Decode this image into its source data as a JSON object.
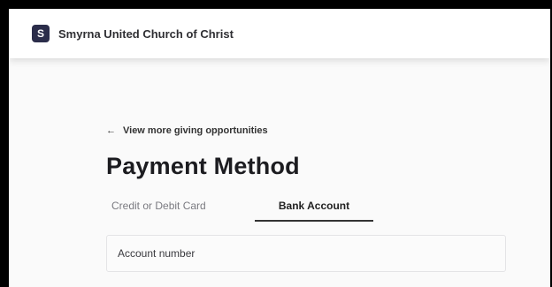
{
  "header": {
    "logo_letter": "S",
    "church_name": "Smyrna United Church of Christ"
  },
  "navigation": {
    "back_arrow": "←",
    "back_link": "View more giving opportunities"
  },
  "page": {
    "title": "Payment Method"
  },
  "tabs": [
    {
      "label": "Credit or Debit Card",
      "selected": false
    },
    {
      "label": "Bank Account",
      "selected": true
    }
  ],
  "form": {
    "account_number": {
      "placeholder": "Account number",
      "value": ""
    }
  },
  "colors": {
    "logo_bg": "#2b2d4a",
    "active_tab_underline": "#333333"
  }
}
